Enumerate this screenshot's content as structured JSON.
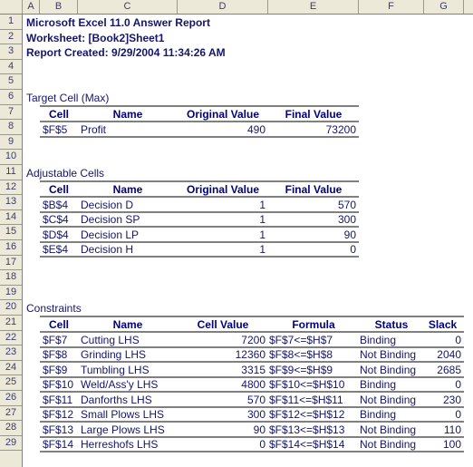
{
  "app": {
    "type": "spreadsheet",
    "column_headers": [
      "A",
      "B",
      "C",
      "D",
      "E",
      "F",
      "G"
    ],
    "row_count": 29,
    "header_bg": "#ECE9D8",
    "header_text_color": "#3B3B6B",
    "body_text_color": "#15156B",
    "table_header_color": "#00007F",
    "rule_color": "#808080"
  },
  "report": {
    "title": "Microsoft Excel 11.0 Answer Report",
    "worksheet": "Worksheet: [Book2]Sheet1",
    "created": "Report Created: 9/29/2004 11:34:26 AM"
  },
  "target_cell": {
    "section_title": "Target Cell (Max)",
    "columns": [
      "Cell",
      "Name",
      "Original Value",
      "Final Value"
    ],
    "rows": [
      {
        "cell": "$F$5",
        "name": "Profit",
        "original_value": "490",
        "final_value": "73200"
      }
    ]
  },
  "adjustable_cells": {
    "section_title": "Adjustable Cells",
    "columns": [
      "Cell",
      "Name",
      "Original Value",
      "Final Value"
    ],
    "rows": [
      {
        "cell": "$B$4",
        "name": "Decision D",
        "original_value": "1",
        "final_value": "570"
      },
      {
        "cell": "$C$4",
        "name": "Decision SP",
        "original_value": "1",
        "final_value": "300"
      },
      {
        "cell": "$D$4",
        "name": "Decision LP",
        "original_value": "1",
        "final_value": "90"
      },
      {
        "cell": "$E$4",
        "name": "Decision H",
        "original_value": "1",
        "final_value": "0"
      }
    ]
  },
  "constraints": {
    "section_title": "Constraints",
    "columns": [
      "Cell",
      "Name",
      "Cell Value",
      "Formula",
      "Status",
      "Slack"
    ],
    "rows": [
      {
        "cell": "$F$7",
        "name": "Cutting LHS",
        "cell_value": "7200",
        "formula": "$F$7<=$H$7",
        "status": "Binding",
        "slack": "0"
      },
      {
        "cell": "$F$8",
        "name": "Grinding LHS",
        "cell_value": "12360",
        "formula": "$F$8<=$H$8",
        "status": "Not Binding",
        "slack": "2040"
      },
      {
        "cell": "$F$9",
        "name": "Tumbling LHS",
        "cell_value": "3315",
        "formula": "$F$9<=$H$9",
        "status": "Not Binding",
        "slack": "2685"
      },
      {
        "cell": "$F$10",
        "name": "Weld/Ass'y LHS",
        "cell_value": "4800",
        "formula": "$F$10<=$H$10",
        "status": "Binding",
        "slack": "0"
      },
      {
        "cell": "$F$11",
        "name": "Danforths LHS",
        "cell_value": "570",
        "formula": "$F$11<=$H$11",
        "status": "Not Binding",
        "slack": "230"
      },
      {
        "cell": "$F$12",
        "name": "Small Plows LHS",
        "cell_value": "300",
        "formula": "$F$12<=$H$12",
        "status": "Binding",
        "slack": "0"
      },
      {
        "cell": "$F$13",
        "name": "Large Plows LHS",
        "cell_value": "90",
        "formula": "$F$13<=$H$13",
        "status": "Not Binding",
        "slack": "110"
      },
      {
        "cell": "$F$14",
        "name": "Herreshofs LHS",
        "cell_value": "0",
        "formula": "$F$14<=$H$14",
        "status": "Not Binding",
        "slack": "100"
      }
    ]
  }
}
